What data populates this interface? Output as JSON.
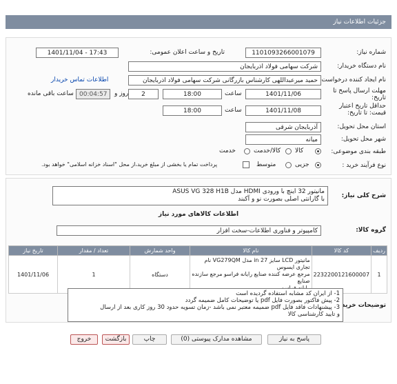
{
  "header": {
    "title": "جزئیات اطلاعات نیاز"
  },
  "form": {
    "need_number": {
      "label": "شماره نیاز:",
      "value": "1101093266001079"
    },
    "announce_datetime": {
      "label": "تاریخ و ساعت اعلان عمومی:",
      "value": "1401/11/04 - 17:43"
    },
    "buyer_org": {
      "label": "نام دستگاه خریدار:",
      "value": "شرکت سهامی فولاد اذربایجان"
    },
    "requester": {
      "label": "نام ایجاد کننده درخواست:",
      "value": "حمید میرعبداللهی کارشناس بازرگانی شرکت سهامی فولاد اذربایجان",
      "contact_link": "اطلاعات تماس خریدار"
    },
    "reply_deadline": {
      "label": "مهلت ارسال پاسخ تا تاریخ:",
      "date": "1401/11/06",
      "time_label": "ساعت",
      "time": "18:00",
      "days": "2",
      "days_label": "روز و",
      "remaining": "00:04:57",
      "remaining_label": "ساعت باقی مانده"
    },
    "price_validity": {
      "label": "حداقل تاریخ اعتبار قیمت: تا تاریخ:",
      "date": "1401/11/08",
      "time_label": "ساعت",
      "time": "18:00"
    },
    "province": {
      "label": "استان محل تحویل:",
      "value": "آذربایجان شرقی"
    },
    "city": {
      "label": "شهر محل تحویل:",
      "value": "میانه"
    },
    "category": {
      "label": "طبقه بندی موضوعی:",
      "options": [
        "کالا",
        "کالا/خدمت",
        "خدمت"
      ]
    },
    "purchase_type": {
      "label": "نوع فرآیند خرید :",
      "options": [
        "جزیی",
        "متوسط"
      ],
      "note": "پرداخت تمام یا بخشی از مبلغ خرید،از محل \"اسناد خزانه اسلامی\" خواهد بود."
    }
  },
  "need": {
    "general_desc_label": "شرح کلی نیاز:",
    "general_desc": "مانیتور 32 اینچ با ورودی HDMI  مدل ASUS VG 328 H1B\nبا گارانتی اصلی بصورت نو و آکبند",
    "goods_info_title": "اطلاعات کالاهای مورد نیاز",
    "goods_group_label": "گروه کالا:",
    "goods_group": "کامپیوتر و فناوری اطلاعات-سخت افزار"
  },
  "table": {
    "headers": [
      "ردیف",
      "کد کالا",
      "نام کالا",
      "واحد شمارش",
      "تعداد / مقدار",
      "تاریخ نیاز"
    ],
    "rows": [
      {
        "row": "1",
        "code": "2232200121600007",
        "name": "مانیتور LCD سایز 27 in مدل VG279QM نام تجاری ایسوس\nمرجع عرضه کننده صنایع رایانه فراسو مرجع سازنده صنایع\nرایانه فراسو",
        "unit": "دستگاه",
        "qty": "1",
        "date": "1401/11/06"
      }
    ]
  },
  "buyer_notes": {
    "label": "توضیحات خریدار:",
    "lines": [
      "1- از ایران کد مشابه استفاده گردیده است",
      "2- پیش فاکتور بصورت فایل pdf یا توضیحات کامل ضمیمه گردد",
      "3- پیشنهادات فاقد فایل pdf  ضمیمه معتبر نمی باشد -زمان تسویه حدود 30 روز کاری بعد از ارسال",
      "و تایید کارشناسی کالا"
    ]
  },
  "buttons": {
    "reply": "پاسخ به نیاز",
    "attachments": "مشاهده مدارک پیوستی (0)",
    "print": "چاپ",
    "back": "بازگشت",
    "exit": "خروج"
  }
}
